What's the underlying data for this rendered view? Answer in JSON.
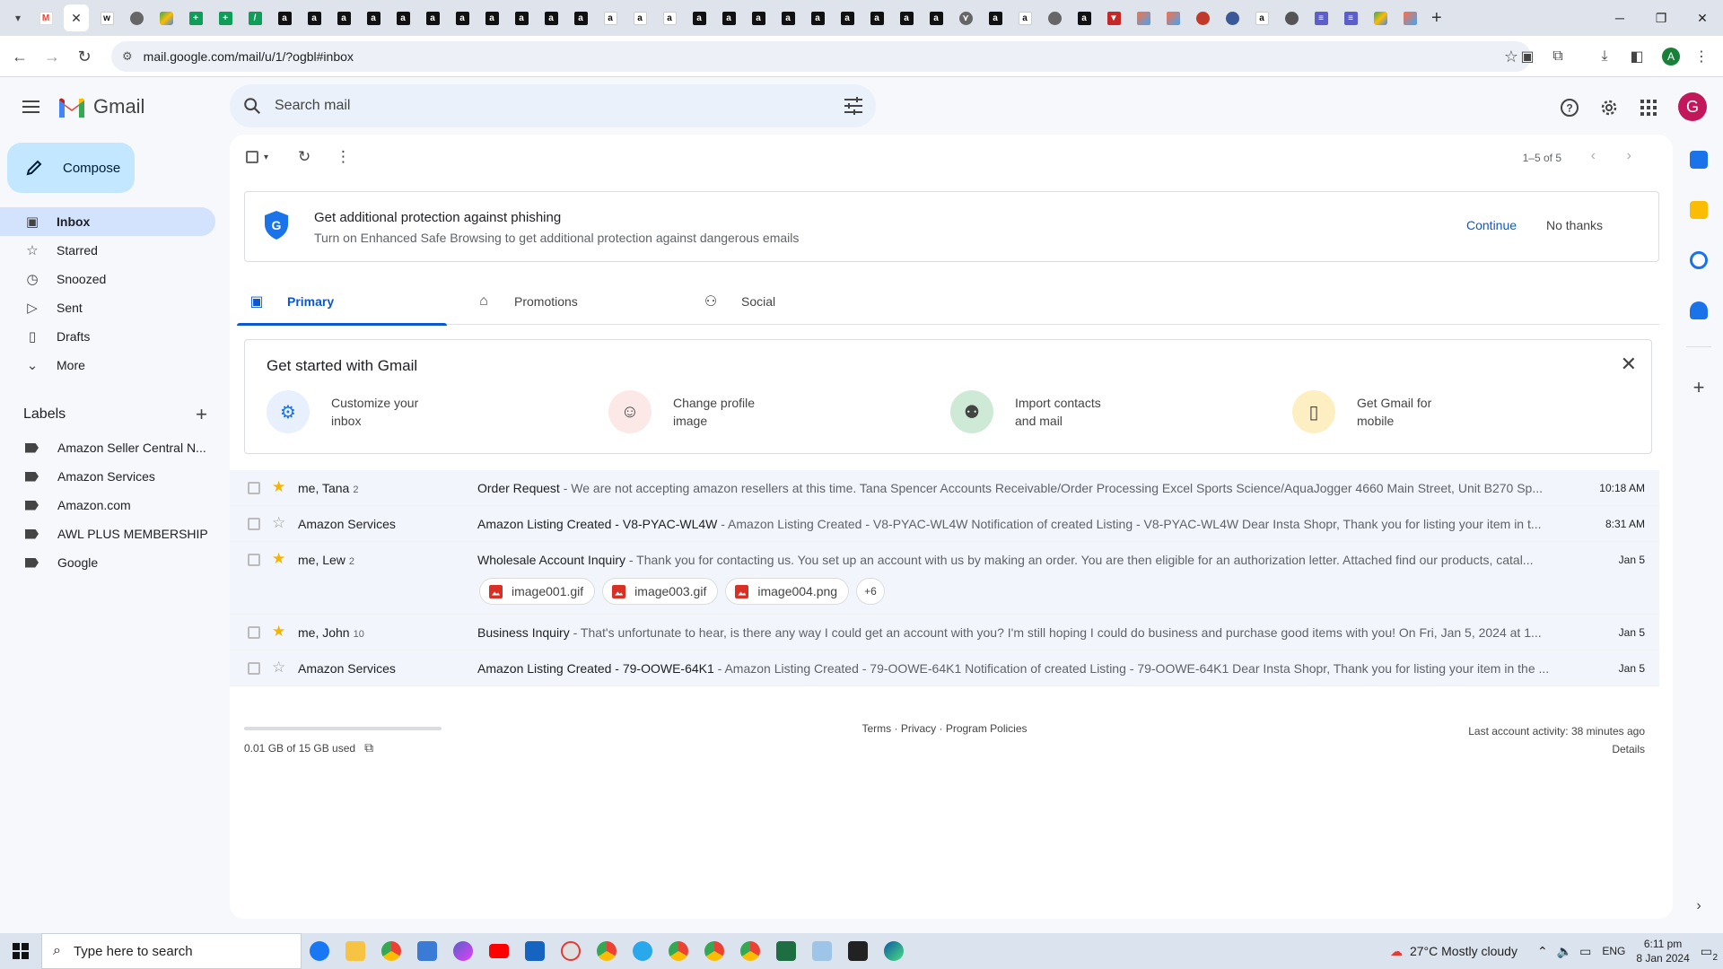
{
  "browser": {
    "url": "mail.google.com/mail/u/1/?ogbl#inbox",
    "profile_initial": "A"
  },
  "header": {
    "app_name": "Gmail",
    "search_placeholder": "Search mail",
    "avatar_initial": "G"
  },
  "sidebar": {
    "compose_label": "Compose",
    "nav": [
      {
        "label": "Inbox",
        "icon": "inbox-icon"
      },
      {
        "label": "Starred",
        "icon": "star-icon"
      },
      {
        "label": "Snoozed",
        "icon": "clock-icon"
      },
      {
        "label": "Sent",
        "icon": "send-icon"
      },
      {
        "label": "Drafts",
        "icon": "draft-icon"
      },
      {
        "label": "More",
        "icon": "chevron-down-icon"
      }
    ],
    "labels_title": "Labels",
    "labels": [
      "Amazon Seller Central N...",
      "Amazon Services",
      "Amazon.com",
      "AWL PLUS MEMBERSHIP",
      "Google"
    ]
  },
  "toolbar": {
    "page_info": "1–5 of 5"
  },
  "phishing_banner": {
    "title": "Get additional protection against phishing",
    "subtitle": "Turn on Enhanced Safe Browsing to get additional protection against dangerous emails",
    "continue": "Continue",
    "no_thanks": "No thanks"
  },
  "tabs": [
    {
      "label": "Primary"
    },
    {
      "label": "Promotions"
    },
    {
      "label": "Social"
    }
  ],
  "get_started": {
    "title": "Get started with Gmail",
    "items": [
      {
        "line1": "Customize your",
        "line2": "inbox",
        "color": "#e8f0fe"
      },
      {
        "line1": "Change profile",
        "line2": "image",
        "color": "#fce8e6"
      },
      {
        "line1": "Import contacts",
        "line2": "and mail",
        "color": "#ceead6"
      },
      {
        "line1": "Get Gmail for",
        "line2": "mobile",
        "color": "#feefc3"
      }
    ]
  },
  "emails": [
    {
      "sender": "me, Tana",
      "count": "2",
      "starred": true,
      "subject": "Order Request",
      "snippet": " - We are not accepting amazon resellers at this time. Tana Spencer Accounts Receivable/Order Processing Excel Sports Science/AquaJogger 4660 Main Street, Unit B270 Sp...",
      "date": "10:18 AM"
    },
    {
      "sender": "Amazon Services",
      "count": "",
      "starred": false,
      "subject": "Amazon Listing Created - V8-PYAC-WL4W",
      "snippet": " - Amazon Listing Created - V8-PYAC-WL4W Notification of created Listing - V8-PYAC-WL4W Dear Insta Shopr, Thank you for listing your item in t...",
      "date": "8:31 AM"
    },
    {
      "sender": "me, Lew",
      "count": "2",
      "starred": true,
      "subject": "Wholesale Account Inquiry",
      "snippet": " - Thank you for contacting us. You set up an account with us by making an order. You are then eligible for an authorization letter. Attached find our products, catal...",
      "date": "Jan 5",
      "attachments": [
        "image001.gif",
        "image003.gif",
        "image004.png"
      ],
      "more_attachments": "+6"
    },
    {
      "sender": "me, John",
      "count": "10",
      "starred": true,
      "subject": "Business Inquiry",
      "snippet": " - That's unfortunate to hear, is there any way I could get an account with you? I'm still hoping I could do business and purchase good items with you! On Fri, Jan 5, 2024 at 1...",
      "date": "Jan 5"
    },
    {
      "sender": "Amazon Services",
      "count": "",
      "starred": false,
      "subject": "Amazon Listing Created - 79-OOWE-64K1",
      "snippet": " - Amazon Listing Created - 79-OOWE-64K1 Notification of created Listing - 79-OOWE-64K1 Dear Insta Shopr, Thank you for listing your item in the ...",
      "date": "Jan 5"
    }
  ],
  "footer": {
    "storage": "0.01 GB of 15 GB used",
    "storage_fraction": 0.001,
    "terms": "Terms · Privacy · Program Policies",
    "activity": "Last account activity: 38 minutes ago",
    "details": "Details"
  },
  "taskbar": {
    "search_placeholder": "Type here to search",
    "weather": "27°C  Mostly cloudy",
    "lang": "ENG",
    "time": "6:11 pm",
    "date": "8 Jan 2024",
    "notif_count": "2"
  }
}
